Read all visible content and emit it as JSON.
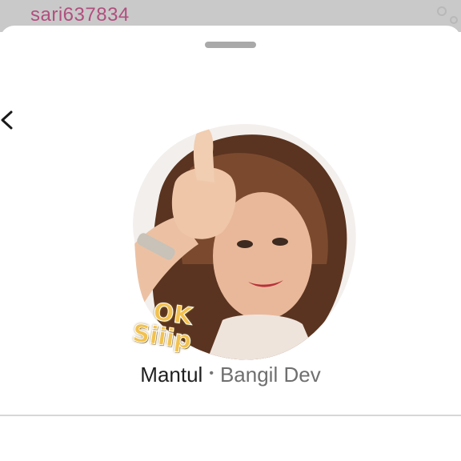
{
  "background": {
    "username": "sari637834"
  },
  "sheet": {
    "back_icon": "chevron-left-icon",
    "sticker": {
      "description_icon": "sticker-image",
      "caption_line1": "OK",
      "caption_line2": "Siiip"
    },
    "pack_name": "Mantul",
    "separator": "•",
    "author": "Bangil Dev"
  },
  "colors": {
    "username": "#b14f7e",
    "caption": "#f2c14e",
    "handle": "#a9a9a9",
    "divider": "#d7d7d7"
  }
}
